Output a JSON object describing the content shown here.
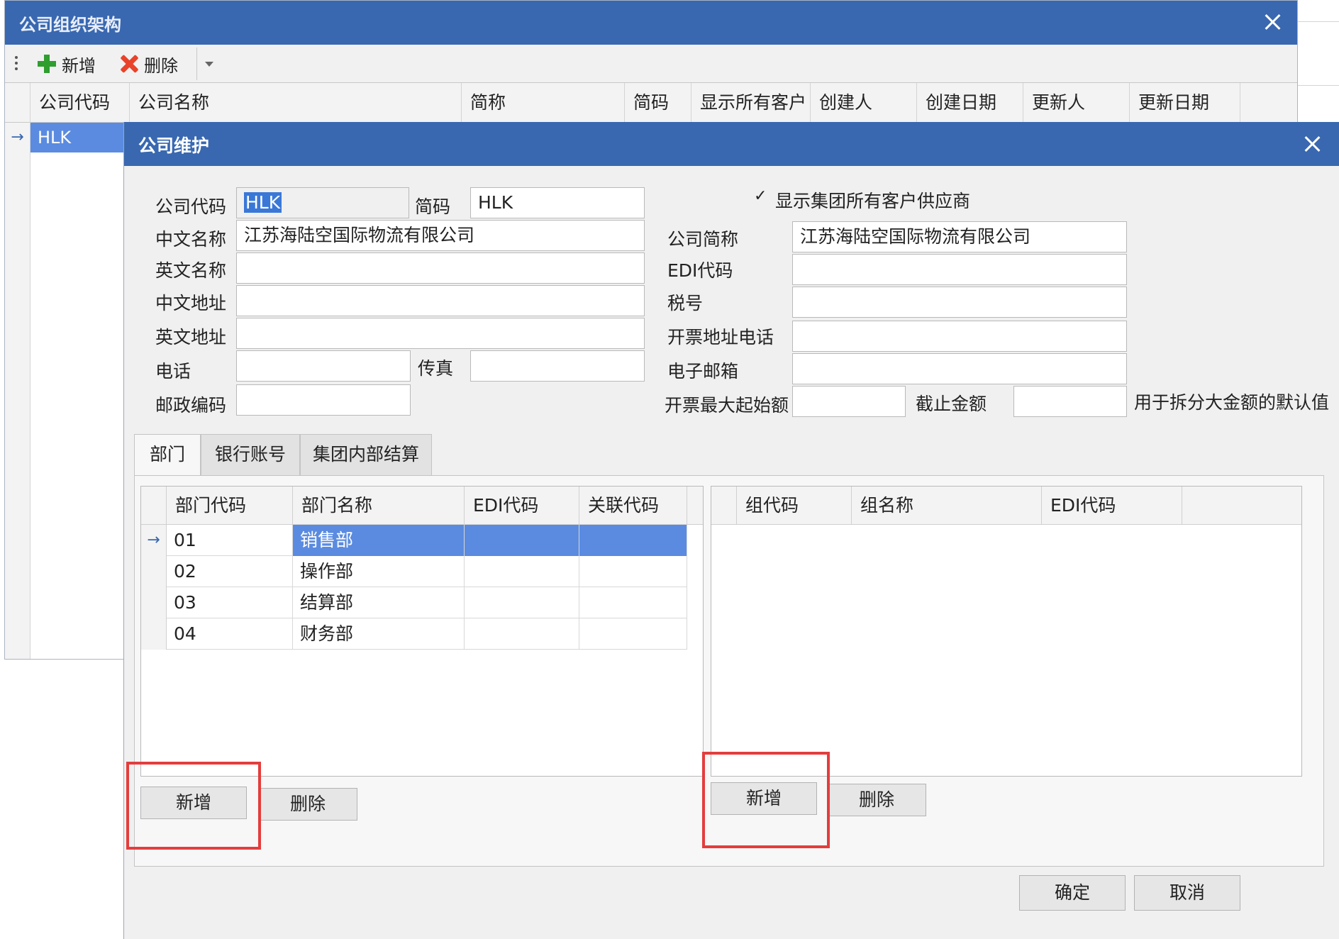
{
  "outer_window": {
    "title": "公司组织架构",
    "toolbar": {
      "add_label": "新增",
      "delete_label": "删除"
    },
    "columns": [
      "公司代码",
      "公司名称",
      "简称",
      "简码",
      "显示所有客户",
      "创建人",
      "创建日期",
      "更新人",
      "更新日期"
    ],
    "rows": [
      {
        "indicator": "→",
        "code": "HLK"
      }
    ]
  },
  "dialog": {
    "title": "公司维护",
    "form": {
      "company_code": {
        "label": "公司代码",
        "value": "HLK"
      },
      "short_code": {
        "label": "简码",
        "value": "HLK"
      },
      "show_all": {
        "label": "显示集团所有客户供应商",
        "checked_mark": "✓"
      },
      "cn_name": {
        "label": "中文名称",
        "value": "江苏海陆空国际物流有限公司"
      },
      "company_short": {
        "label": "公司简称",
        "value": "江苏海陆空国际物流有限公司"
      },
      "en_name": {
        "label": "英文名称",
        "value": ""
      },
      "edi_code": {
        "label": "EDI代码",
        "value": ""
      },
      "cn_address": {
        "label": "中文地址",
        "value": ""
      },
      "tax_no": {
        "label": "税号",
        "value": ""
      },
      "en_address": {
        "label": "英文地址",
        "value": ""
      },
      "invoice_addr_phone": {
        "label": "开票地址电话",
        "value": ""
      },
      "phone": {
        "label": "电话",
        "value": ""
      },
      "fax": {
        "label": "传真",
        "value": ""
      },
      "email": {
        "label": "电子邮箱",
        "value": ""
      },
      "postcode": {
        "label": "邮政编码",
        "value": ""
      },
      "invoice_max_start": {
        "label": "开票最大起始额",
        "value": ""
      },
      "cutoff_amount": {
        "label": "截止金额",
        "value": ""
      },
      "split_hint": "用于拆分大金额的默认值"
    },
    "tabs": [
      "部门",
      "银行账号",
      "集团内部结算"
    ],
    "dept_grid": {
      "columns": [
        "部门代码",
        "部门名称",
        "EDI代码",
        "关联代码"
      ],
      "rows": [
        {
          "indicator": "→",
          "code": "01",
          "name": "销售部",
          "edi": "",
          "link": ""
        },
        {
          "indicator": "",
          "code": "02",
          "name": "操作部",
          "edi": "",
          "link": ""
        },
        {
          "indicator": "",
          "code": "03",
          "name": "结算部",
          "edi": "",
          "link": ""
        },
        {
          "indicator": "",
          "code": "04",
          "name": "财务部",
          "edi": "",
          "link": ""
        }
      ],
      "add_label": "新增",
      "delete_label": "删除"
    },
    "group_grid": {
      "columns": [
        "组代码",
        "组名称",
        "EDI代码"
      ],
      "add_label": "新增",
      "delete_label": "删除"
    },
    "ok_label": "确定",
    "cancel_label": "取消"
  },
  "colors": {
    "title_bar": "#3968b0",
    "selection": "#5a8be0",
    "highlight_box": "#e43d3d",
    "add_icon": "#2f9e2f",
    "delete_icon": "#e8422a"
  }
}
